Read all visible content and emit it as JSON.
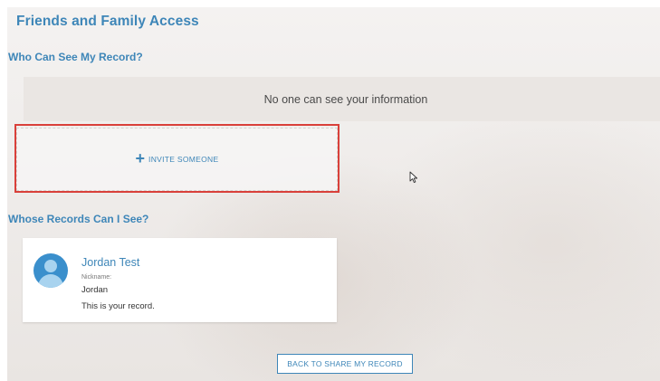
{
  "page": {
    "title": "Friends and Family Access"
  },
  "who_can_see": {
    "heading": "Who Can See My Record?",
    "empty_message": "No one can see your information",
    "invite_label": "INVITE SOMEONE"
  },
  "whose_records": {
    "heading": "Whose Records Can I See?",
    "records": [
      {
        "name": "Jordan Test",
        "nickname_label": "Nickname:",
        "nickname": "Jordan",
        "note": "This is your record."
      }
    ]
  },
  "footer": {
    "back_label": "BACK TO SHARE MY RECORD"
  },
  "icons": {
    "invite": "plus-icon",
    "avatar": "person-avatar-icon",
    "pointer": "mouse-cursor-icon"
  },
  "colors": {
    "accent": "#3e86b8",
    "highlight_border": "#d9403a",
    "avatar": "#3a8fcc"
  }
}
